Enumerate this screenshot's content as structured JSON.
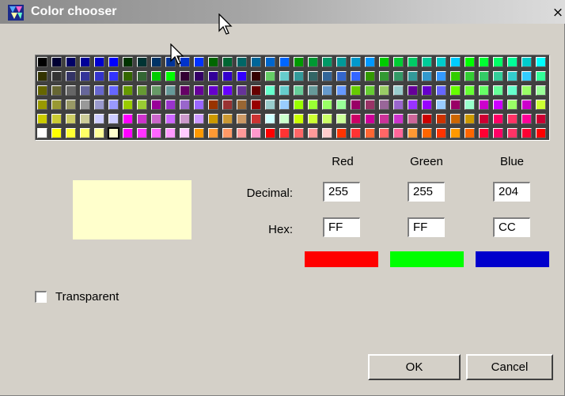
{
  "window": {
    "title": "Color chooser",
    "close_symbol": "×",
    "close_icon": "close-icon",
    "app_icon": "color-chooser-app-icon"
  },
  "palette": {
    "rows": [
      [
        "#000000",
        "#000033",
        "#000066",
        "#000099",
        "#0000cc",
        "#0000ff",
        "#003300",
        "#003333",
        "#003366",
        "#003399",
        "#0033cc",
        "#0033ff",
        "#006600",
        "#006633",
        "#006666",
        "#006699",
        "#0066cc",
        "#0066ff",
        "#009900",
        "#009933",
        "#009966",
        "#009999",
        "#0099cc",
        "#0099ff",
        "#00cc00",
        "#00cc33",
        "#00cc66",
        "#00cc99",
        "#00cccc",
        "#00ccff",
        "#00ff00",
        "#00ff33",
        "#00ff66",
        "#00ff99",
        "#00cccc",
        "#00ffff"
      ],
      [
        "#333300",
        "#333333",
        "#333366",
        "#333399",
        "#3333cc",
        "#3333ff",
        "#336600",
        "#336633",
        "#00cc00",
        "#00ff00",
        "#330033",
        "#330066",
        "#330099",
        "#3300cc",
        "#3300ff",
        "#330000",
        "#66cc66",
        "#66cccc",
        "#339999",
        "#336666",
        "#336699",
        "#3366cc",
        "#3366ff",
        "#339900",
        "#339933",
        "#339966",
        "#339999",
        "#3399cc",
        "#3399ff",
        "#33cc00",
        "#33cc33",
        "#33cc66",
        "#33cc99",
        "#33cccc",
        "#33ccff",
        "#33ff99"
      ],
      [
        "#666600",
        "#666633",
        "#666666",
        "#666699",
        "#6666cc",
        "#6666ff",
        "#669900",
        "#669933",
        "#669966",
        "#669999",
        "#660066",
        "#660099",
        "#6600cc",
        "#6600ff",
        "#663399",
        "#660000",
        "#66ffcc",
        "#66cccc",
        "#66cc99",
        "#669999",
        "#6699cc",
        "#6699ff",
        "#66cc00",
        "#66cc33",
        "#99cc66",
        "#99cccc",
        "#660099",
        "#6600cc",
        "#6666ff",
        "#66ff00",
        "#66ff33",
        "#66ff66",
        "#66ff99",
        "#66ffcc",
        "#99ff66",
        "#99ff99"
      ],
      [
        "#999900",
        "#999933",
        "#999966",
        "#999999",
        "#9999cc",
        "#9999ff",
        "#99cc00",
        "#99cc33",
        "#990099",
        "#9933cc",
        "#9966cc",
        "#9966ff",
        "#993300",
        "#993333",
        "#996633",
        "#990000",
        "#99cccc",
        "#99ccff",
        "#99ff00",
        "#99ff33",
        "#99ff66",
        "#99ff99",
        "#990066",
        "#993366",
        "#996699",
        "#9966cc",
        "#9933ff",
        "#9900ff",
        "#99ccff",
        "#990066",
        "#99ffcc",
        "#cc00cc",
        "#cc00ff",
        "#99ff66",
        "#cc00cc",
        "#ccff33"
      ],
      [
        "#cccc00",
        "#cccc33",
        "#cccc66",
        "#cccc99",
        "#ccccff",
        "#ccccff",
        "#ff00ff",
        "#cc33cc",
        "#cc66cc",
        "#cc66ff",
        "#cc99cc",
        "#cc99ff",
        "#cc9900",
        "#cc9933",
        "#cc9966",
        "#cc3333",
        "#ccffff",
        "#ccffcc",
        "#ccff00",
        "#ccff33",
        "#ccff66",
        "#ccff99",
        "#cc0066",
        "#cc0099",
        "#cc3399",
        "#cc33cc",
        "#cc6699",
        "#cc0000",
        "#cc3300",
        "#cc6600",
        "#cc9900",
        "#cc0033",
        "#ff0066",
        "#ff3366",
        "#ff0099",
        "#cc0033"
      ],
      [
        "#ffffff",
        "#ffff00",
        "#ffff33",
        "#ffff66",
        "#ffff99",
        "#ffffcc",
        "#ff00ff",
        "#ff33ff",
        "#ff66ff",
        "#ff99ff",
        "#ffccff",
        "#ff9900",
        "#ff9933",
        "#ff9966",
        "#ff9999",
        "#ff99cc",
        "#ff0000",
        "#ff3333",
        "#ff6666",
        "#ff9999",
        "#ffcccc",
        "#ff3300",
        "#ff3333",
        "#ff6633",
        "#ff6666",
        "#ff6699",
        "#ff9933",
        "#ff6600",
        "#ff3300",
        "#ff9900",
        "#ff6600",
        "#ff0033",
        "#ff0066",
        "#ff3366",
        "#ff0033",
        "#ff0000"
      ]
    ],
    "selected_row": 5,
    "selected_col": 5
  },
  "channels": {
    "red_label": "Red",
    "green_label": "Green",
    "blue_label": "Blue"
  },
  "decimal": {
    "label": "Decimal:",
    "red": "255",
    "green": "255",
    "blue": "204"
  },
  "hex": {
    "label": "Hex:",
    "red": "FF",
    "green": "FF",
    "blue": "CC"
  },
  "preview_color": "#ffffcc",
  "bar_colors": {
    "red": "#ff0000",
    "green": "#00ff00",
    "blue": "#0000cc"
  },
  "transparent": {
    "label": "Transparent",
    "checked": false
  },
  "buttons": {
    "ok": "OK",
    "cancel": "Cancel"
  }
}
